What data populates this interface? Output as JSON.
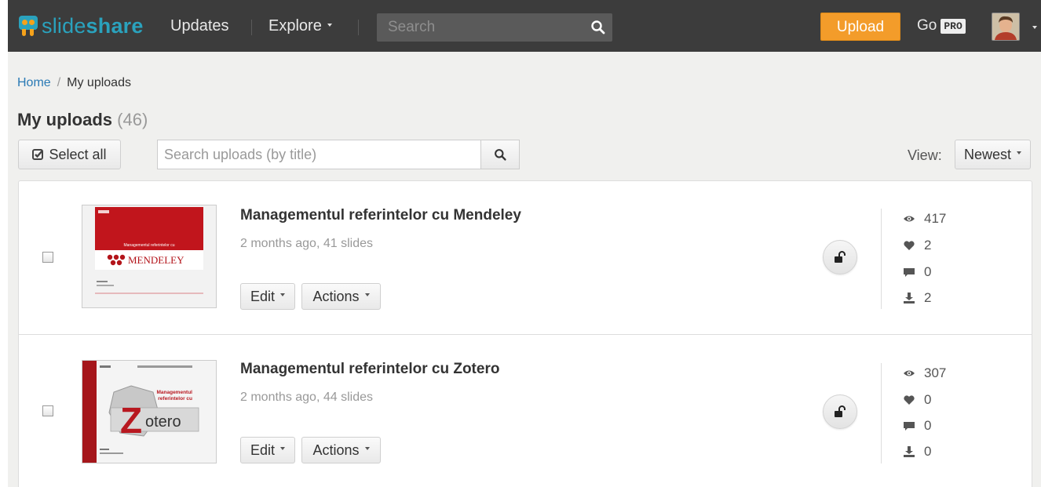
{
  "header": {
    "logo_light": "slide",
    "logo_bold": "share",
    "nav": {
      "updates": "Updates",
      "explore": "Explore"
    },
    "search_placeholder": "Search",
    "upload_label": "Upload",
    "go_label": "Go",
    "pro_label": "PRO"
  },
  "breadcrumb": {
    "home": "Home",
    "sep": "/",
    "current": "My uploads"
  },
  "page": {
    "title": "My uploads",
    "count": "(46)"
  },
  "toolbar": {
    "select_all": "Select all",
    "search_placeholder": "Search uploads (by title)",
    "view_label": "View:",
    "sort_value": "Newest"
  },
  "uploads": [
    {
      "title": "Managementul referintelor cu Mendeley",
      "meta": "2 months ago, 41 slides",
      "edit": "Edit",
      "actions": "Actions",
      "views": "417",
      "likes": "2",
      "comments": "0",
      "downloads": "2",
      "thumb_text": "MENDELEY",
      "thumb_subtitle": "Managementul referintelor cu"
    },
    {
      "title": "Managementul referintelor cu Zotero",
      "meta": "2 months ago, 44 slides",
      "edit": "Edit",
      "actions": "Actions",
      "views": "307",
      "likes": "0",
      "comments": "0",
      "downloads": "0",
      "thumb_letter": "Z",
      "thumb_text": "otero",
      "thumb_subtitle_1": "Managementul",
      "thumb_subtitle_2": "referintelor cu"
    }
  ],
  "colors": {
    "topbar": "#3c3c3c",
    "brand": "#2aa2bd",
    "upload": "#f39c2a",
    "link": "#2a7ab5"
  }
}
